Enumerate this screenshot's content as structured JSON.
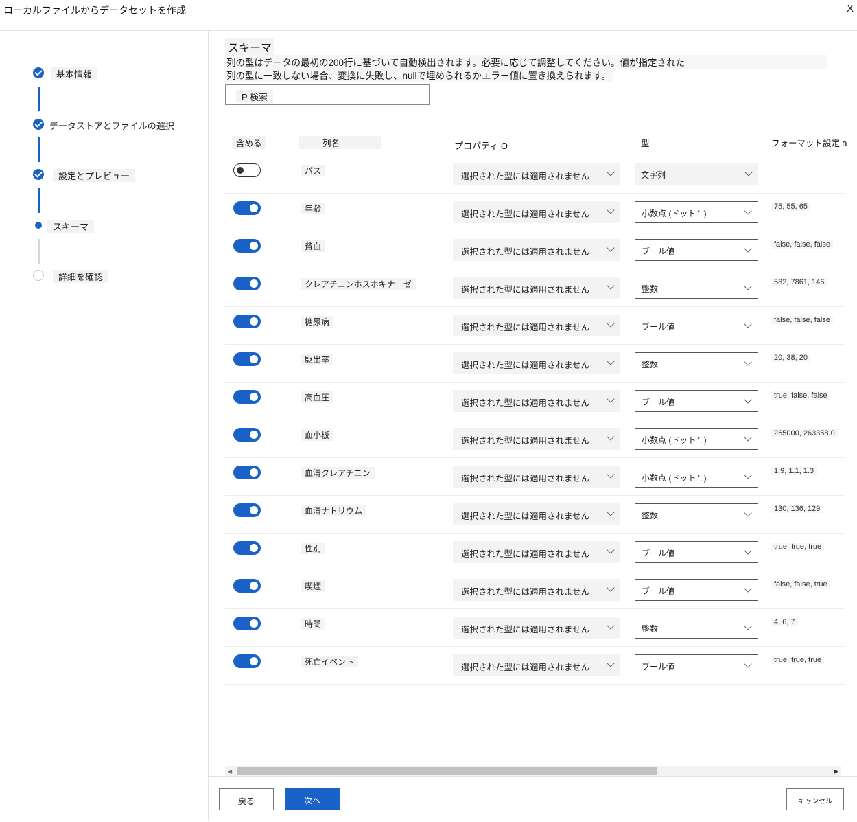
{
  "window": {
    "title": "ローカルファイルからデータセットを作成",
    "close_label": "X"
  },
  "steps": [
    {
      "label": "基本情報",
      "state": "done"
    },
    {
      "label": "データストアとファイルの選択",
      "state": "done"
    },
    {
      "label": "設定とプレビュー",
      "state": "done"
    },
    {
      "label": "スキーマ",
      "state": "current"
    },
    {
      "label": "詳細を確認",
      "state": "todo"
    }
  ],
  "schema": {
    "title": "スキーマ",
    "desc_line1": "列の型はデータの最初の200行に基づいて自動検出されます。必要に応じて調整してください。値が指定された",
    "desc_line2": "列の型に一致しない場合、変換に失敗し、nullで埋められるかエラー値に置き換えられます。",
    "search_label": "P 検索"
  },
  "columns": {
    "include": "含める",
    "name": "列名",
    "properties": "プロパティ O",
    "type": "型",
    "format": "フォーマット設定 a"
  },
  "rows": [
    {
      "include": false,
      "name": "パス",
      "property": "選択された型には適用されません",
      "type": "文字列",
      "format": ""
    },
    {
      "include": true,
      "name": "年齢",
      "property": "選択された型には適用されません",
      "type": "小数点 (ドット '.')",
      "format": "75, 55, 65"
    },
    {
      "include": true,
      "name": "貧血",
      "property": "選択された型には適用されません",
      "type": "ブール値",
      "format": "false, false, false"
    },
    {
      "include": true,
      "name": "クレアチニンホスホキナーゼ",
      "property": "選択された型には適用されません",
      "type": "整数",
      "format": "582, 7861, 146"
    },
    {
      "include": true,
      "name": "糖尿病",
      "property": "選択された型には適用されません",
      "type": "ブール値",
      "format": "false, false, false"
    },
    {
      "include": true,
      "name": "駆出率",
      "property": "選択された型には適用されません",
      "type": "整数",
      "format": "20, 38, 20"
    },
    {
      "include": true,
      "name": "高血圧",
      "property": "選択された型には適用されません",
      "type": "ブール値",
      "format": "true, false, false"
    },
    {
      "include": true,
      "name": "血小板",
      "property": "選択された型には適用されません",
      "type": "小数点 (ドット '.')",
      "format": "265000, 263358.0"
    },
    {
      "include": true,
      "name": "血清クレアチニン",
      "property": "選択された型には適用されません",
      "type": "小数点 (ドット '.')",
      "format": "1.9, 1.1, 1.3"
    },
    {
      "include": true,
      "name": "血清ナトリウム",
      "property": "選択された型には適用されません",
      "type": "整数",
      "format": "130, 136, 129"
    },
    {
      "include": true,
      "name": "性別",
      "property": "選択された型には適用されません",
      "type": "ブール値",
      "format": "true, true, true"
    },
    {
      "include": true,
      "name": "喫煙",
      "property": "選択された型には適用されません",
      "type": "ブール値",
      "format": "false, false, true"
    },
    {
      "include": true,
      "name": "時間",
      "property": "選択された型には適用されません",
      "type": "整数",
      "format": "4, 6, 7"
    },
    {
      "include": true,
      "name": "死亡イベント",
      "property": "選択された型には適用されません",
      "type": "ブール値",
      "format": "true, true, true"
    }
  ],
  "footer": {
    "back": "戻る",
    "next": "次へ",
    "cancel": "キャンセル"
  },
  "colors": {
    "accent": "#1a62c8"
  }
}
